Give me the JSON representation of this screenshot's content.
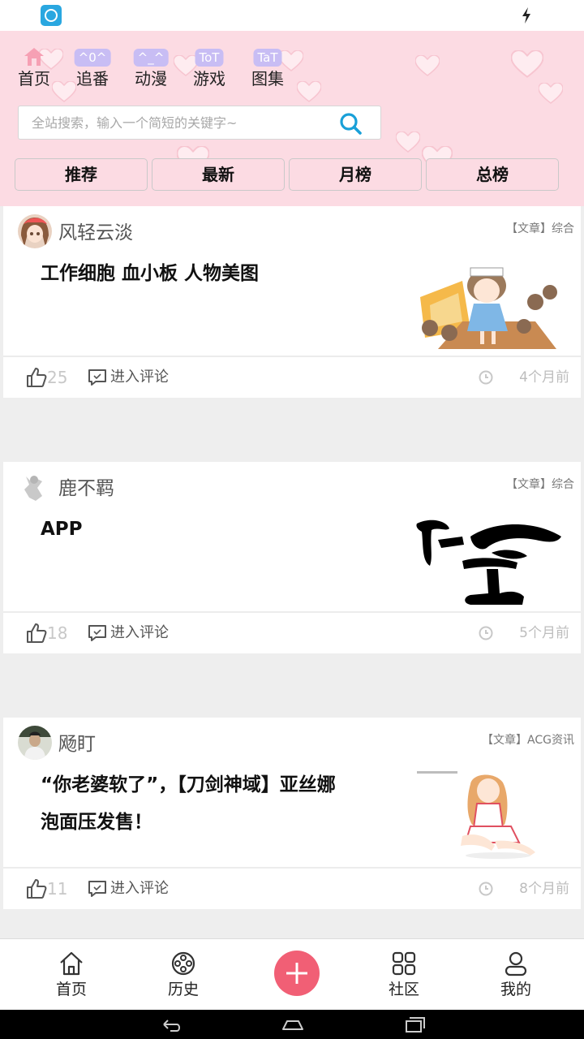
{
  "nav": {
    "items": [
      {
        "face": "",
        "label": "首页"
      },
      {
        "face": "^0^",
        "label": "追番"
      },
      {
        "face": "^_^",
        "label": "动漫"
      },
      {
        "face": "ToT",
        "label": "游戏"
      },
      {
        "face": "TaT",
        "label": "图集"
      }
    ]
  },
  "search": {
    "placeholder": "全站搜索，输入一个简短的关键字~"
  },
  "tabs": [
    {
      "label": "推荐"
    },
    {
      "label": "最新"
    },
    {
      "label": "月榜"
    },
    {
      "label": "总榜"
    }
  ],
  "posts": [
    {
      "author": "风轻云淡",
      "category": "【文章】综合",
      "title": "工作细胞 血小板 人物美图",
      "likes": "25",
      "comment_label": "进入评论",
      "time": "4个月前"
    },
    {
      "author": "鹿不羁",
      "category": "【文章】综合",
      "title": "APP",
      "likes": "18",
      "comment_label": "进入评论",
      "time": "5个月前"
    },
    {
      "author": "飏盯",
      "category": "【文章】ACG资讯",
      "title": "“你老婆软了”，【刀剑神域】亚丝娜泡面压发售！",
      "likes": "11",
      "comment_label": "进入评论",
      "time": "8个月前"
    }
  ],
  "bottom_nav": {
    "home": "首页",
    "history": "历史",
    "community": "社区",
    "mine": "我的"
  },
  "colors": {
    "header_bg": "#fcdbe3",
    "accent": "#f15f75",
    "face_badge": "#c8bdf4",
    "search_icon": "#19a0d8"
  }
}
